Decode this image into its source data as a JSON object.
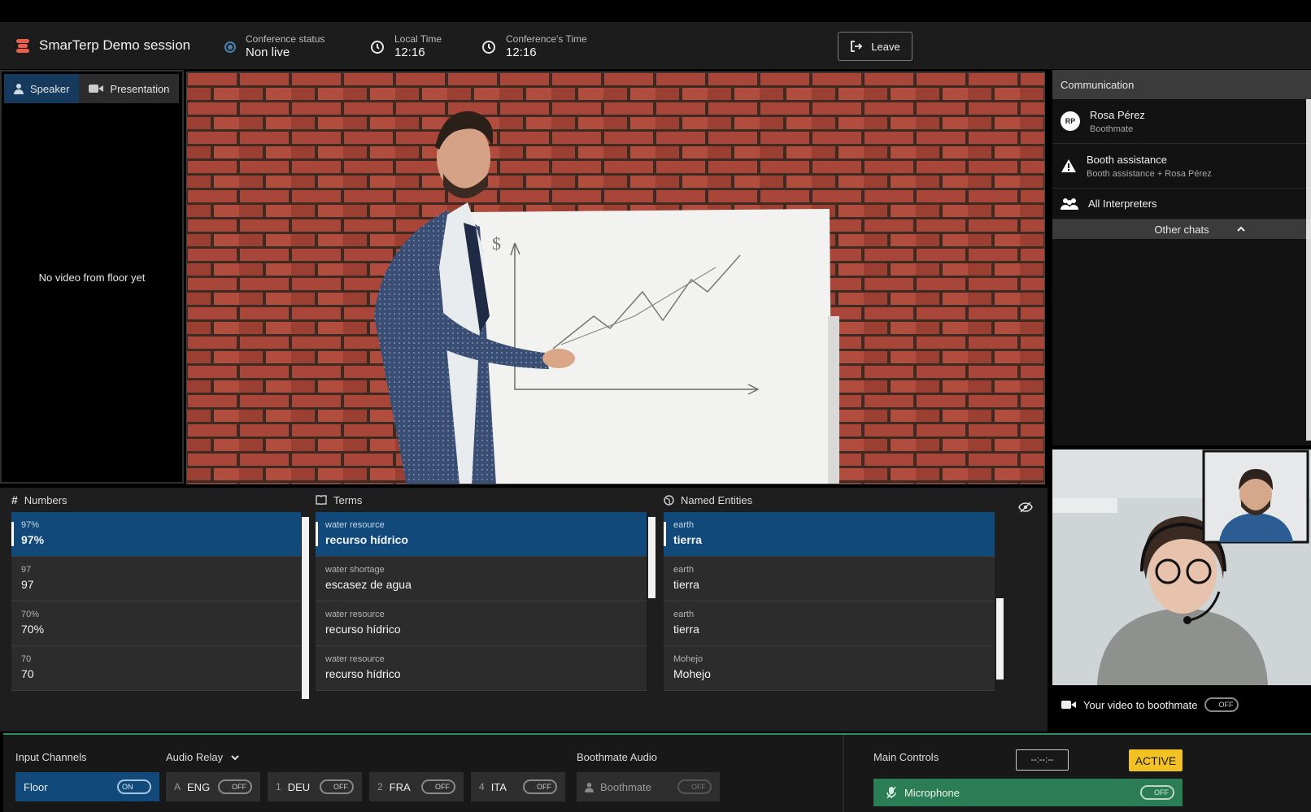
{
  "header": {
    "app_title": "SmarTerp Demo session",
    "conference_status_label": "Conference status",
    "conference_status_value": "Non live",
    "local_time_label": "Local Time",
    "local_time_value": "12:16",
    "conference_time_label": "Conference's Time",
    "conference_time_value": "12:16",
    "leave_label": "Leave"
  },
  "video_tabs": {
    "speaker": "Speaker",
    "presentation": "Presentation"
  },
  "floor_video_message": "No video from floor yet",
  "communication": {
    "title": "Communication",
    "chats": [
      {
        "initials": "RP",
        "name": "Rosa Pérez",
        "sub": "Boothmate"
      },
      {
        "name": "Booth assistance",
        "sub": "Booth assistance + Rosa Pérez"
      },
      {
        "name": "All Interpreters"
      }
    ],
    "other_chats_label": "Other chats"
  },
  "camera": {
    "video_toggle_label": "Your video to boothmate",
    "video_toggle_state": "OFF"
  },
  "results": {
    "numbers": {
      "title": "Numbers",
      "items": [
        {
          "src": "97%",
          "tgt": "97%"
        },
        {
          "src": "97",
          "tgt": "97"
        },
        {
          "src": "70%",
          "tgt": "70%"
        },
        {
          "src": "70",
          "tgt": "70"
        }
      ]
    },
    "terms": {
      "title": "Terms",
      "items": [
        {
          "src": "water resource",
          "tgt": "recurso hídrico"
        },
        {
          "src": "water shortage",
          "tgt": "escasez de agua"
        },
        {
          "src": "water resource",
          "tgt": "recurso hídrico"
        },
        {
          "src": "water resource",
          "tgt": "recurso hídrico"
        }
      ]
    },
    "entities": {
      "title": "Named Entities",
      "items": [
        {
          "src": "earth",
          "tgt": "tierra"
        },
        {
          "src": "earth",
          "tgt": "tierra"
        },
        {
          "src": "earth",
          "tgt": "tierra"
        },
        {
          "src": "Mohejo",
          "tgt": "Mohejo"
        }
      ]
    }
  },
  "bottom": {
    "input_channels_title": "Input Channels",
    "audio_relay_title": "Audio Relay",
    "boothmate_audio_title": "Boothmate Audio",
    "main_controls_title": "Main Controls",
    "floor": {
      "label": "Floor",
      "state": "ON"
    },
    "channels": [
      {
        "num": "A",
        "code": "ENG",
        "state": "OFF"
      },
      {
        "num": "1",
        "code": "DEU",
        "state": "OFF"
      },
      {
        "num": "2",
        "code": "FRA",
        "state": "OFF"
      },
      {
        "num": "4",
        "code": "ITA",
        "state": "OFF"
      }
    ],
    "boothmate": {
      "label": "Boothmate",
      "state": "OFF"
    },
    "timer": "--:--:--",
    "active_badge": "ACTIVE",
    "microphone": {
      "label": "Microphone",
      "state": "OFF"
    }
  },
  "colors": {
    "accent_blue": "#114a7a",
    "active_yellow": "#f2c124",
    "mic_green": "#2a7d55",
    "brand_red": "#e8604c"
  }
}
